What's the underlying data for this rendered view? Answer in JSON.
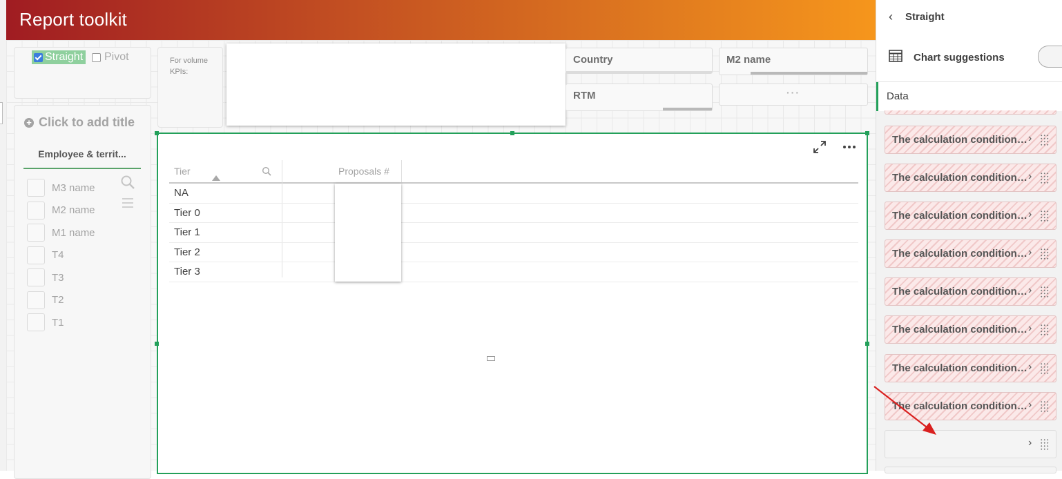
{
  "header": {
    "title": "Report toolkit"
  },
  "toggle": {
    "straight_label": "Straight",
    "pivot_label": "Pivot"
  },
  "filter_panel": {
    "add_title": "Click to add title",
    "tab_label": "Employee & territ...",
    "items": [
      "M3 name",
      "M2 name",
      "M1 name",
      "T4",
      "T3",
      "T2",
      "T1"
    ]
  },
  "kpi_note": {
    "text": "For volume KPIs:"
  },
  "dimensions": {
    "country": "Country",
    "m2_name": "M2 name",
    "rtm": "RTM",
    "more": "···"
  },
  "table": {
    "columns": [
      "Tier",
      "Proposals #"
    ],
    "rows": [
      "NA",
      "Tier 0",
      "Tier 1",
      "Tier 2",
      "Tier 3"
    ]
  },
  "panel": {
    "back_title": "Straight",
    "chart_suggestions": "Chart suggestions",
    "data_tab": "Data",
    "calc_items": [
      "The calculation condition is not fulfilled",
      "The calculation condition is not fulfilled",
      "The calculation condition is not fulfilled",
      "The calculation condition is not fulfilled",
      "The calculation condition is not fulfilled",
      "The calculation condition is not fulfilled",
      "The calculation condition is not fulfilled",
      "The calculation condition is not fulfilled"
    ],
    "empty_item": ""
  },
  "colors": {
    "accent_green": "#23a05a",
    "header_start": "#a01c22",
    "header_end": "#f6961c",
    "annotation_arrow": "#d9201f"
  },
  "icons": [
    "back-chevron-icon",
    "chart-suggestions-icon",
    "search-icon",
    "list-menu-icon",
    "expand-icon",
    "more-options-icon",
    "drag-handle-icon",
    "chevron-right-icon",
    "plus-circle-icon",
    "sort-ascending-icon"
  ]
}
